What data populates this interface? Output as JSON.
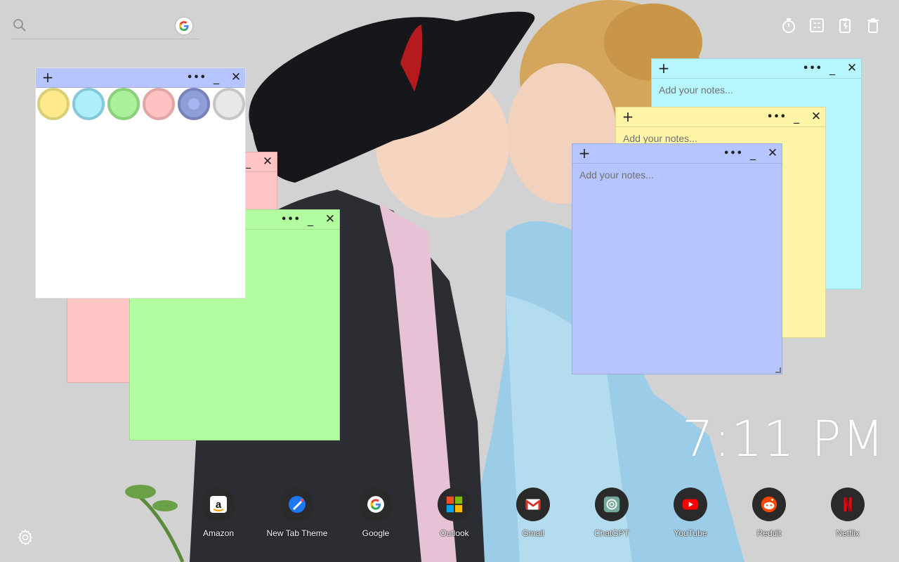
{
  "search": {
    "placeholder": "",
    "search_icon": "search-icon",
    "engine_icon": "google-icon"
  },
  "tools": [
    {
      "name": "timer-icon"
    },
    {
      "name": "calculator-icon"
    },
    {
      "name": "clipboard-icon"
    },
    {
      "name": "trash-icon"
    }
  ],
  "notes": [
    {
      "color": "#b8f6ff",
      "placeholder": "Add your notes..."
    },
    {
      "color": "#fff5a6",
      "placeholder": "Add your notes..."
    },
    {
      "color": "#b6c4ff",
      "placeholder": "Add your notes..."
    },
    {
      "color": "#ffc4c4",
      "placeholder": ""
    },
    {
      "color": "#b2fda0",
      "placeholder": ""
    },
    {
      "color": "#ffffff",
      "placeholder": ""
    }
  ],
  "note_controls": {
    "add": "+",
    "more": "•••",
    "minimize": "_",
    "close": "✕"
  },
  "color_picker": [
    "#fde98c",
    "#aeeffc",
    "#aaf09a",
    "#ffc1c1",
    "#8f9ed6",
    "#e8e8e8"
  ],
  "clock": {
    "time": "7:11 PM"
  },
  "shortcuts": [
    {
      "label": "Amazon",
      "icon": "amazon-icon"
    },
    {
      "label": "New Tab Theme",
      "icon": "new-tab-theme-icon"
    },
    {
      "label": "Google",
      "icon": "google-icon"
    },
    {
      "label": "Outlook",
      "icon": "outlook-icon"
    },
    {
      "label": "Gmail",
      "icon": "gmail-icon"
    },
    {
      "label": "ChatGPT",
      "icon": "chatgpt-icon"
    },
    {
      "label": "YouTube",
      "icon": "youtube-icon"
    },
    {
      "label": "Reddit",
      "icon": "reddit-icon"
    },
    {
      "label": "Netflix",
      "icon": "netflix-icon"
    }
  ],
  "settings_icon": "gear-icon"
}
